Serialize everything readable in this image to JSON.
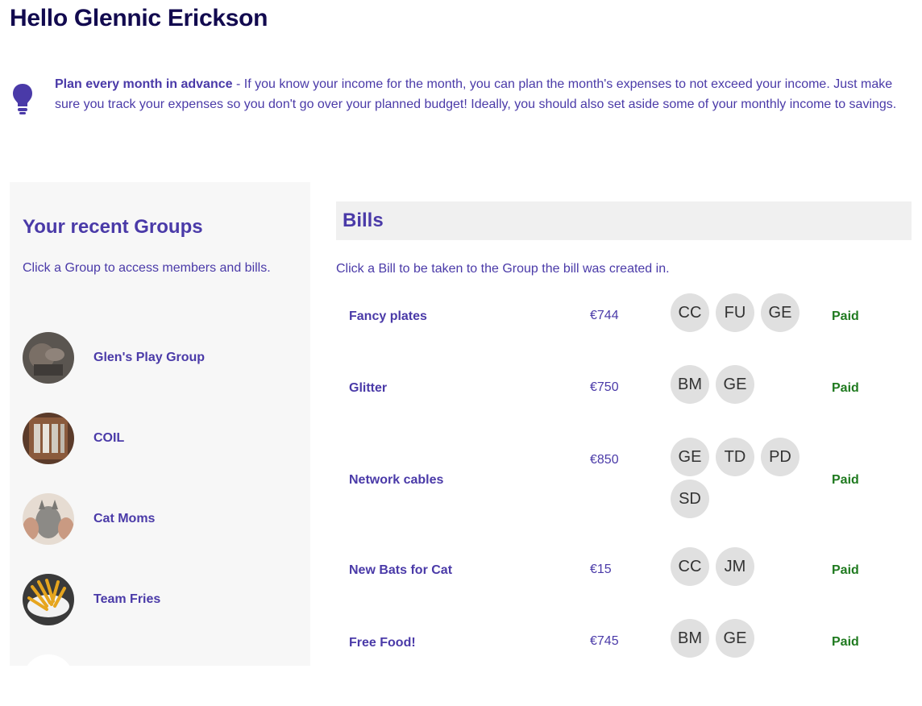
{
  "greeting": "Hello Glennic Erickson",
  "tip": {
    "icon": "lightbulb-icon",
    "title": "Plan every month in advance",
    "body": " - If you know your income for the month, you can plan the month's expenses to not exceed your income. Just make sure you track your expenses so you don't go over your planned budget! Ideally, you should also set aside some of your monthly income to savings."
  },
  "groups": {
    "title": "Your recent Groups",
    "description": "Click a Group to access members and bills.",
    "items": [
      {
        "name": "Glen's Play Group"
      },
      {
        "name": "COIL"
      },
      {
        "name": "Cat Moms"
      },
      {
        "name": "Team Fries"
      }
    ]
  },
  "bills": {
    "title": "Bills",
    "description": "Click a Bill to be taken to the Group the bill was created in.",
    "items": [
      {
        "name": "Fancy plates",
        "amount": "€744",
        "members": [
          "CC",
          "FU",
          "GE"
        ],
        "status": "Paid"
      },
      {
        "name": "Glitter",
        "amount": "€750",
        "members": [
          "BM",
          "GE"
        ],
        "status": "Paid"
      },
      {
        "name": "Network cables",
        "amount": "€850",
        "members": [
          "GE",
          "TD",
          "PD",
          "SD"
        ],
        "status": "Paid"
      },
      {
        "name": "New Bats for Cat",
        "amount": "€15",
        "members": [
          "CC",
          "JM"
        ],
        "status": "Paid"
      },
      {
        "name": "Free Food!",
        "amount": "€745",
        "members": [
          "BM",
          "GE"
        ],
        "status": "Paid"
      }
    ]
  },
  "colors": {
    "primary": "#4a3aa8",
    "heading": "#120a4f",
    "paid": "#1f7a1f",
    "chip": "#e0e0e0"
  }
}
